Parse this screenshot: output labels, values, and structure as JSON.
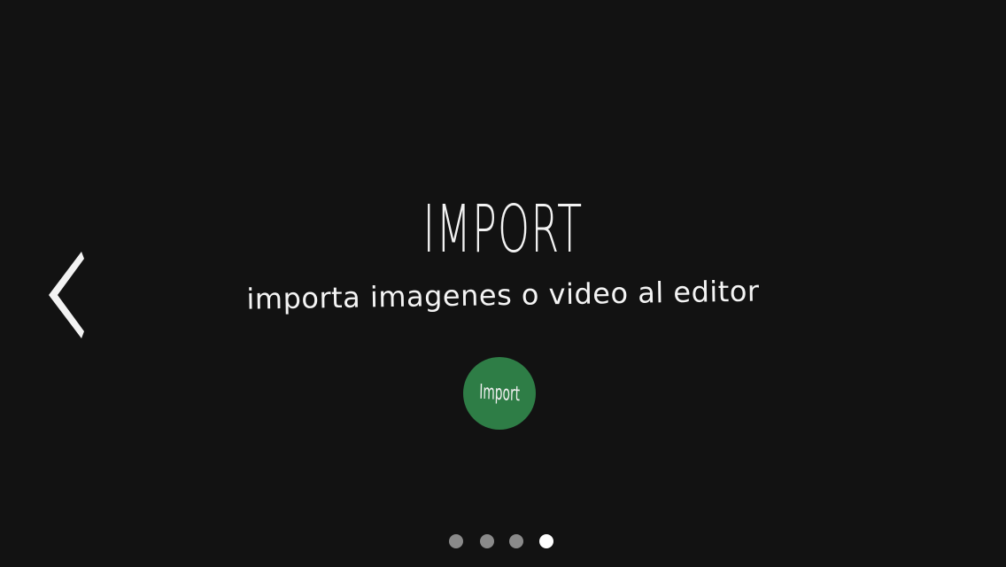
{
  "slide": {
    "title": "IMPORT",
    "subtitle": "importa imagenes o video al editor",
    "import_button_label": "Import"
  },
  "pagination": {
    "total": 4,
    "current": 4
  },
  "colors": {
    "background": "#121212",
    "text": "#f2f2f2",
    "button": "#2e7d46",
    "dot_inactive": "#8a8a8a",
    "dot_active": "#ffffff"
  },
  "icons": {
    "back": "chevron-left-icon"
  }
}
